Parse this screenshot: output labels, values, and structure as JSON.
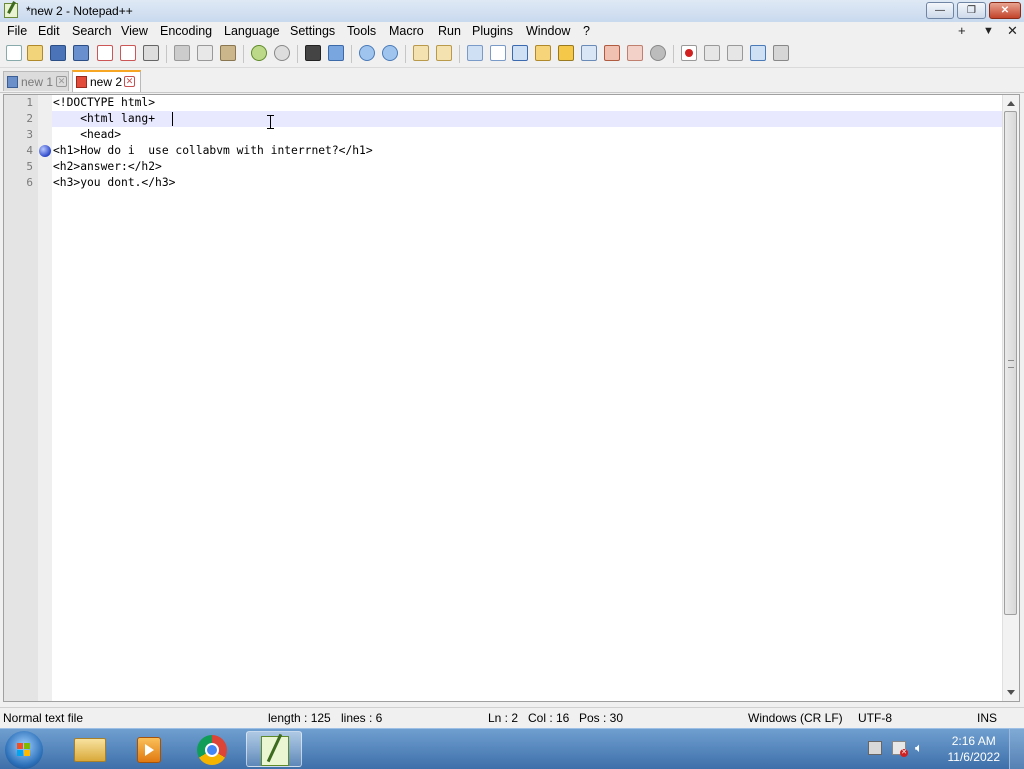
{
  "window": {
    "title": "*new 2 - Notepad++"
  },
  "menu": {
    "items": [
      "File",
      "Edit",
      "Search",
      "View",
      "Encoding",
      "Language",
      "Settings",
      "Tools",
      "Macro",
      "Run",
      "Plugins",
      "Window",
      "?"
    ],
    "right": [
      "+",
      "▼",
      "✕"
    ]
  },
  "tabs": [
    {
      "label": "new 1",
      "close": "✕"
    },
    {
      "label": "new 2",
      "close": "✕"
    }
  ],
  "editor": {
    "line_numbers": [
      "1",
      "2",
      "3",
      "4",
      "5",
      "6"
    ],
    "lines": [
      "<!DOCTYPE html>",
      "    <html lang+",
      "    <head>",
      "<h1>How do i  use collabvm with interrnet?</h1>",
      "<h2>answer:</h2>",
      "<h3>you dont.</h3>"
    ],
    "current_line": 2,
    "bookmark_line": 4
  },
  "status": {
    "file_type": "Normal text file",
    "length": "length : 125",
    "lines": "lines : 6",
    "ln": "Ln : 2",
    "col": "Col : 16",
    "pos": "Pos : 30",
    "eol": "Windows (CR LF)",
    "encoding": "UTF-8",
    "mode": "INS"
  },
  "taskbar": {
    "time": "2:16 AM",
    "date": "11/6/2022",
    "apps": [
      "explorer-icon",
      "media-player-icon",
      "chrome-icon",
      "notepadpp-icon"
    ]
  },
  "colors": {
    "current_line_bg": "#e8e8ff",
    "active_tab_accent": "#f7a623",
    "bookmark": "#2a46c8"
  }
}
